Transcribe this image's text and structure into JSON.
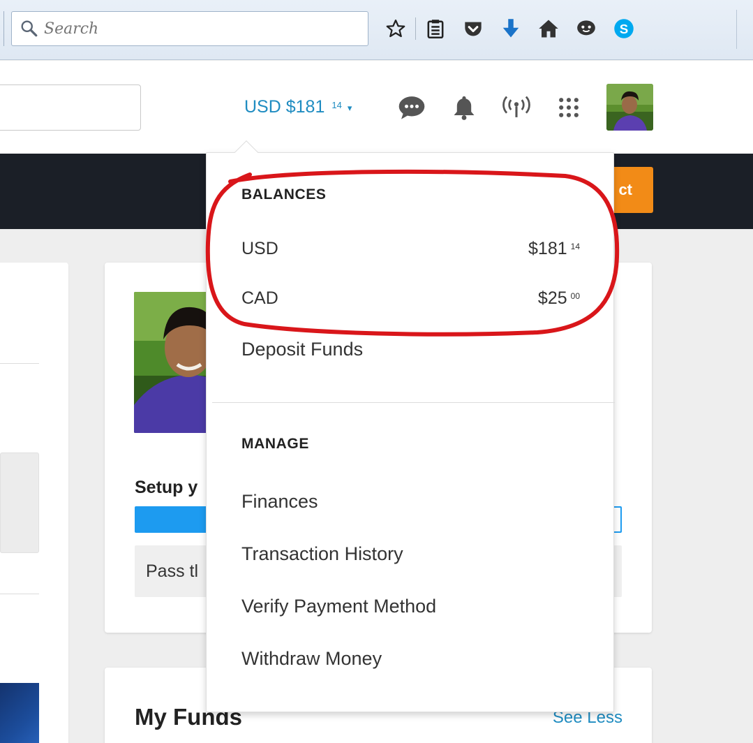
{
  "browser": {
    "search_placeholder": "Search",
    "icons": [
      "star-icon",
      "reading-list-icon",
      "pocket-icon",
      "download-icon",
      "home-icon",
      "chat-icon",
      "skype-icon"
    ]
  },
  "header": {
    "balance_currency_amount": "USD $181",
    "balance_cents": "14",
    "caret": "▾",
    "icons": [
      "messages-icon",
      "notifications-icon",
      "broadcast-icon",
      "apps-grid-icon"
    ]
  },
  "nav": {
    "action_label": "ct"
  },
  "dropdown": {
    "balances_heading": "BALANCES",
    "balances": [
      {
        "currency": "USD",
        "amount": "$181",
        "cents": "14"
      },
      {
        "currency": "CAD",
        "amount": "$25",
        "cents": "00"
      }
    ],
    "deposit_label": "Deposit Funds",
    "manage_heading": "MANAGE",
    "manage_links": [
      "Finances",
      "Transaction History",
      "Verify Payment Method",
      "Withdraw Money"
    ]
  },
  "profile": {
    "setup_title": "Setup y",
    "progress_fraction": 0.15,
    "pass_text": "Pass tl"
  },
  "funds": {
    "title": "My Funds",
    "see_less": "See Less"
  },
  "colors": {
    "accent_blue": "#1f8cc1",
    "progress_blue": "#1d9bf0",
    "action_orange": "#f28b17",
    "nav_dark": "#1b1f27",
    "annotation_red": "#d9161a"
  }
}
